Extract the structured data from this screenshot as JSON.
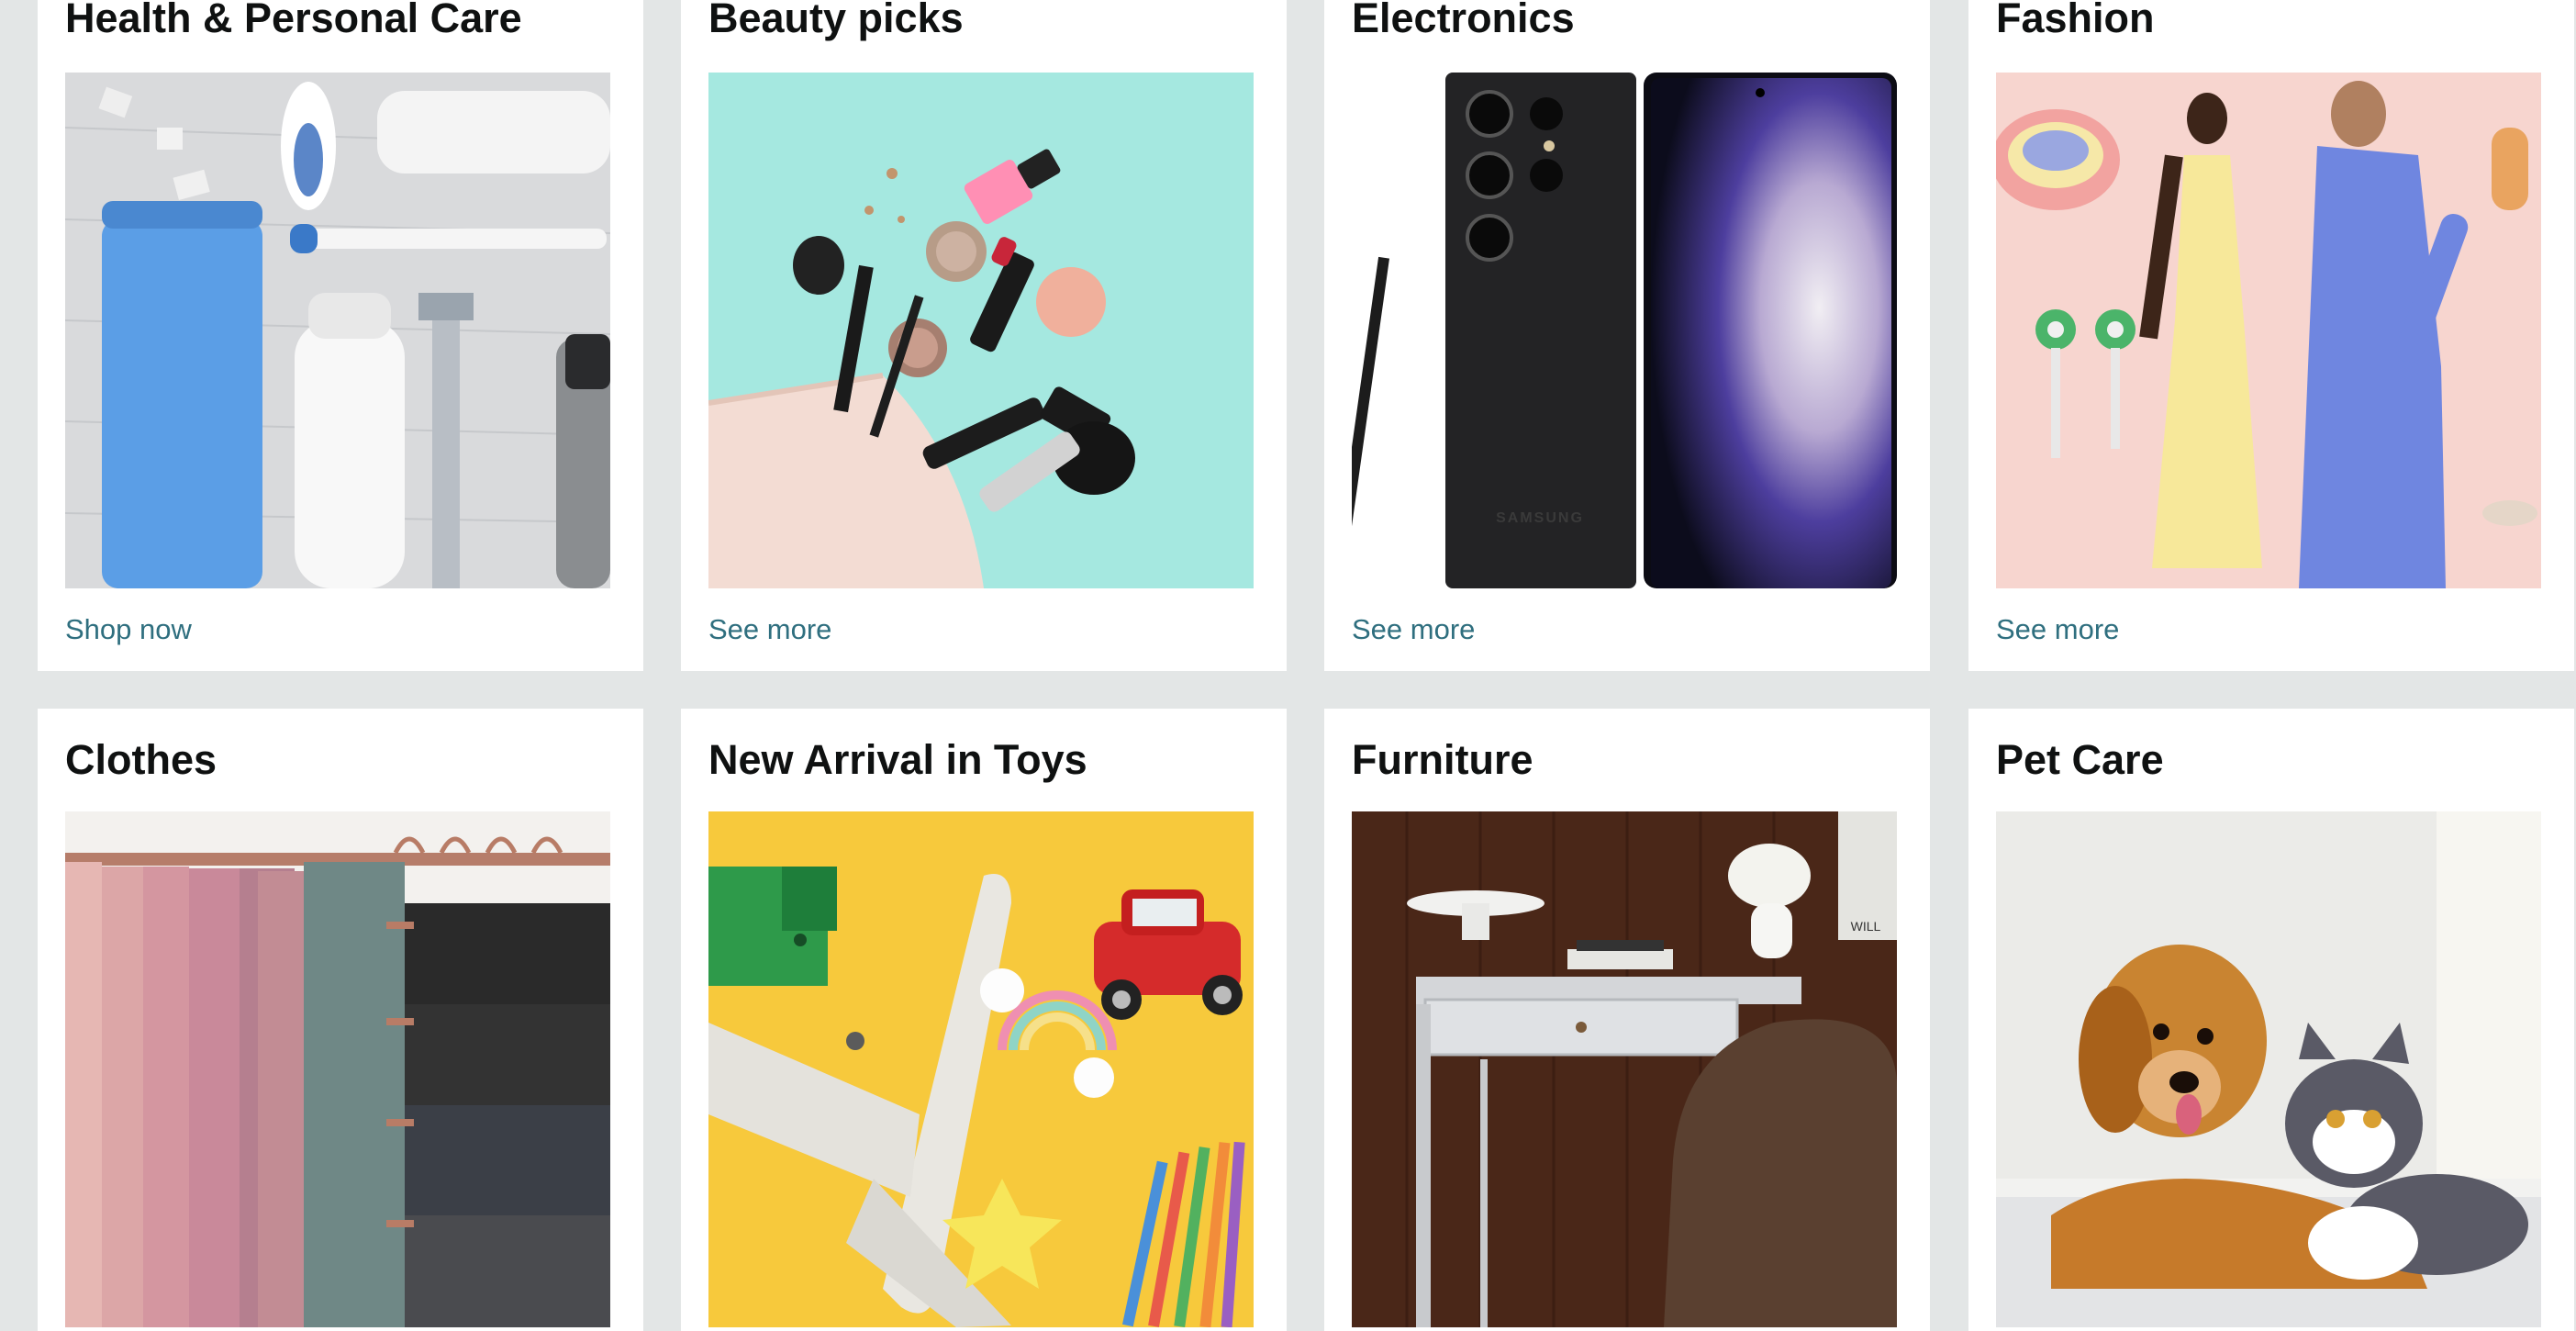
{
  "cards": [
    {
      "title": "Health & Personal Care",
      "link": "Shop now",
      "image": "health-personal-care-products-photo"
    },
    {
      "title": "Beauty picks",
      "link": "See more",
      "image": "makeup-pouch-photo"
    },
    {
      "title": "Electronics",
      "link": "See more",
      "image": "samsung-smartphone-photo"
    },
    {
      "title": "Fashion",
      "link": "See more",
      "image": "fashion-models-photo"
    },
    {
      "title": "Clothes",
      "link": "",
      "image": "hanging-clothes-photo"
    },
    {
      "title": "New Arrival in Toys",
      "link": "",
      "image": "toys-airplane-car-photo"
    },
    {
      "title": "Furniture",
      "link": "",
      "image": "desk-chair-photo"
    },
    {
      "title": "Pet Care",
      "link": "",
      "image": "dog-and-cat-photo"
    }
  ],
  "phone_brand": "SAMSUNG",
  "furniture_sign": "WILL",
  "colors": {
    "page_background": "#e3e6e6",
    "link": "#2f6f7f",
    "title": "#0f1111"
  }
}
